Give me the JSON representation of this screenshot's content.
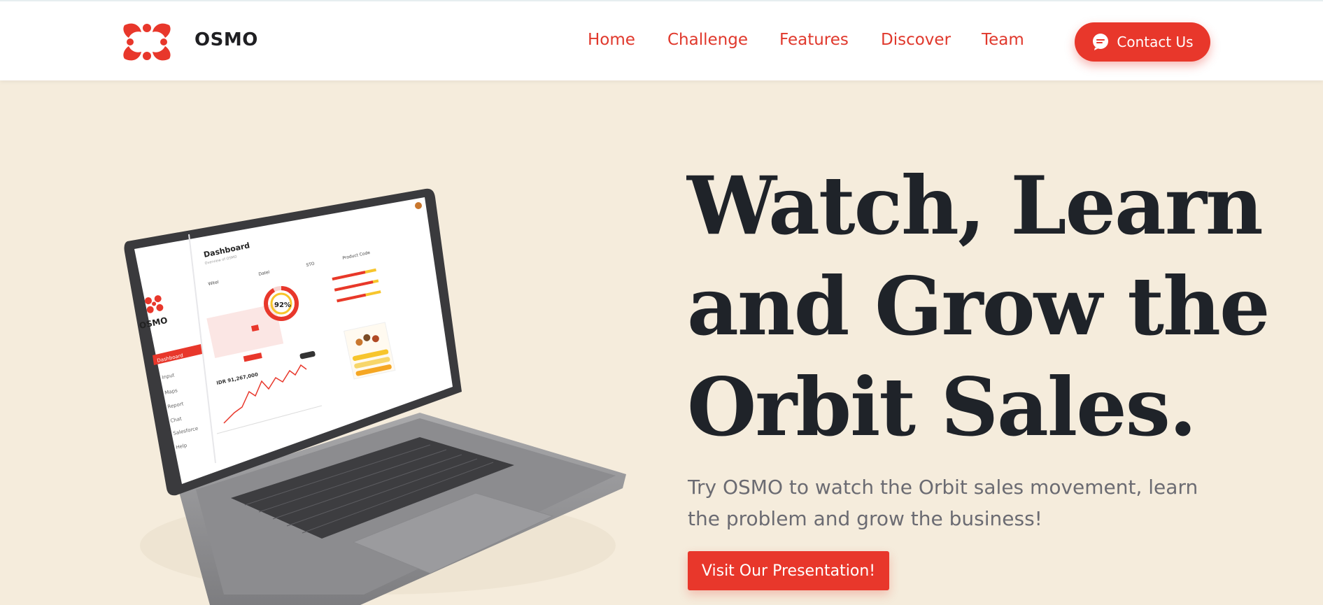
{
  "brand": {
    "name": "OSMO",
    "icon": "osmo-logo-icon",
    "accent": "#e8372b"
  },
  "nav": {
    "items": [
      "Home",
      "Challenge",
      "Features",
      "Discover",
      "Team"
    ],
    "contact_label": "Contact Us",
    "contact_icon": "chat-bubble-icon"
  },
  "hero": {
    "headline": [
      "Watch, Learn",
      "and Grow the",
      "Orbit Sales."
    ],
    "subtext": "Try OSMO to watch the Orbit sales movement, learn the problem and grow the business!",
    "cta_label": "Visit Our Presentation!"
  },
  "laptop_screen": {
    "brand": "OSMO",
    "title": "Dashboard",
    "subtitle": "Overview of OSMO",
    "donut_value": "92%",
    "donut_fraction": 0.92,
    "price": "IDR 91,267,000",
    "sidebar": [
      "Dashboard",
      "Input",
      "Maps",
      "Report",
      "Chat",
      "Salesforce",
      "Help"
    ],
    "filters": [
      "Witel",
      "Datel",
      "STO",
      "Product Code"
    ]
  }
}
